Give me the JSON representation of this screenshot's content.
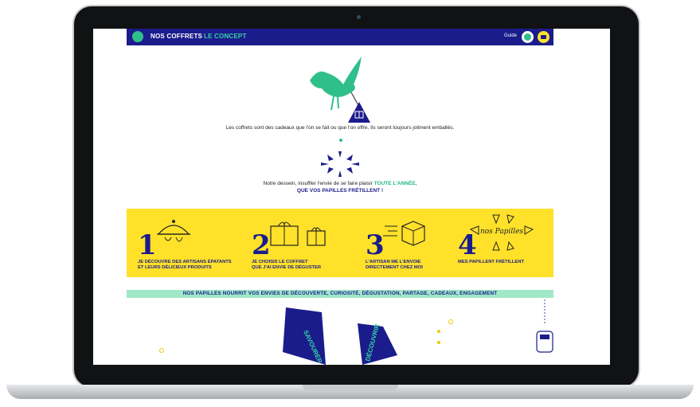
{
  "navbar": {
    "coffrets_label": "NOS COFFRETS",
    "concept_label": "LE CONCEPT",
    "guide_label": "Guide"
  },
  "intro": {
    "text": "Les coffrets sont des cadeaux que l'on se fait ou que l'on offre. Ils seront toujours joliment emballés."
  },
  "dessein": {
    "text": "Notre dessein, insuffler l'envie de se faire plaisir",
    "highlight_green": "TOUTE L'ANNÉE,",
    "highlight_blue": "QUE VOS PAPILLES FRÉTILLENT !"
  },
  "steps": [
    {
      "number": "1",
      "line1": "JE DÉCOUVRE DES ARTISANS ÉPATANTS",
      "line2": "ET LEURS DÉLICIEUX PRODUITS"
    },
    {
      "number": "2",
      "line1": "JE CHOISIS LE COFFRET",
      "line2": "QUE J'AI ENVIE DE DÉGUSTER"
    },
    {
      "number": "3",
      "line1": "L'ARTISAN ME L'ENVOIE",
      "line2": "DIRECTEMENT CHEZ MOI"
    },
    {
      "number": "4",
      "line1": "MES PAPILLENT FRÉTILLENT",
      "line2": "",
      "logo_text": "nos Papilles"
    }
  ],
  "tagline": "NOS PAPILLES NOURRIT VOS ENVIES DE DÉCOUVERTE, CURIOSITÉ, DÉGUSTATION, PARTAGE, CADEAUX, ENGAGEMENT",
  "shapes": {
    "savourer": "SAVOURER",
    "decouvrir": "DÉCOUVRIR"
  },
  "colors": {
    "navy": "#1b1c8c",
    "green": "#2fbf8a",
    "yellow": "#ffe12a",
    "mint": "#9fe8c8"
  }
}
